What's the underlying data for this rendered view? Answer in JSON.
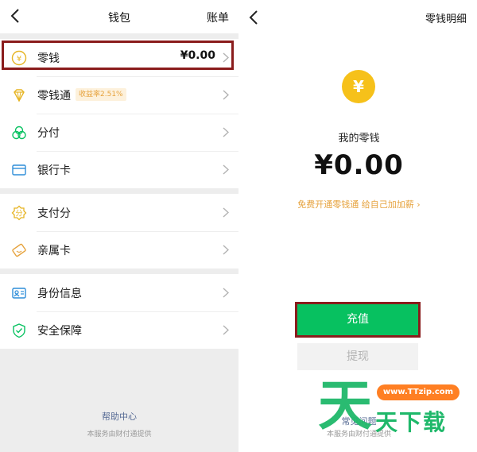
{
  "wallet": {
    "title": "钱包",
    "bill_label": "账单",
    "groups": [
      [
        {
          "icon": "yuan-coin-icon",
          "label": "零钱",
          "value": "¥0.00"
        },
        {
          "icon": "diamond-icon",
          "label": "零钱通",
          "badge": "收益率2.51%"
        },
        {
          "icon": "installment-icon",
          "label": "分付"
        },
        {
          "icon": "bank-card-icon",
          "label": "银行卡"
        }
      ],
      [
        {
          "icon": "payscore-icon",
          "label": "支付分"
        },
        {
          "icon": "family-card-icon",
          "label": "亲属卡"
        }
      ],
      [
        {
          "icon": "id-info-icon",
          "label": "身份信息"
        },
        {
          "icon": "shield-icon",
          "label": "安全保障"
        }
      ]
    ],
    "help_center": "帮助中心",
    "provider": "本服务由财付通提供"
  },
  "change": {
    "detail_label": "零钱明细",
    "coin_symbol": "¥",
    "my_change_label": "我的零钱",
    "balance": "¥0.00",
    "promo": "免费开通零钱通 给自己加加薪 ›",
    "recharge_label": "充值",
    "withdraw_label": "提现",
    "faq_label": "常见问题",
    "provider": "本服务由财付通提供"
  },
  "watermark": {
    "glyph": "天",
    "url": "www.TTzip.com",
    "text": "天下载"
  },
  "colors": {
    "wechat_green": "#07c160",
    "highlight_border": "#8a1c1c",
    "coin_yellow": "#f6c11a",
    "promo_orange": "#e6a23c",
    "link_blue": "#576b95"
  }
}
